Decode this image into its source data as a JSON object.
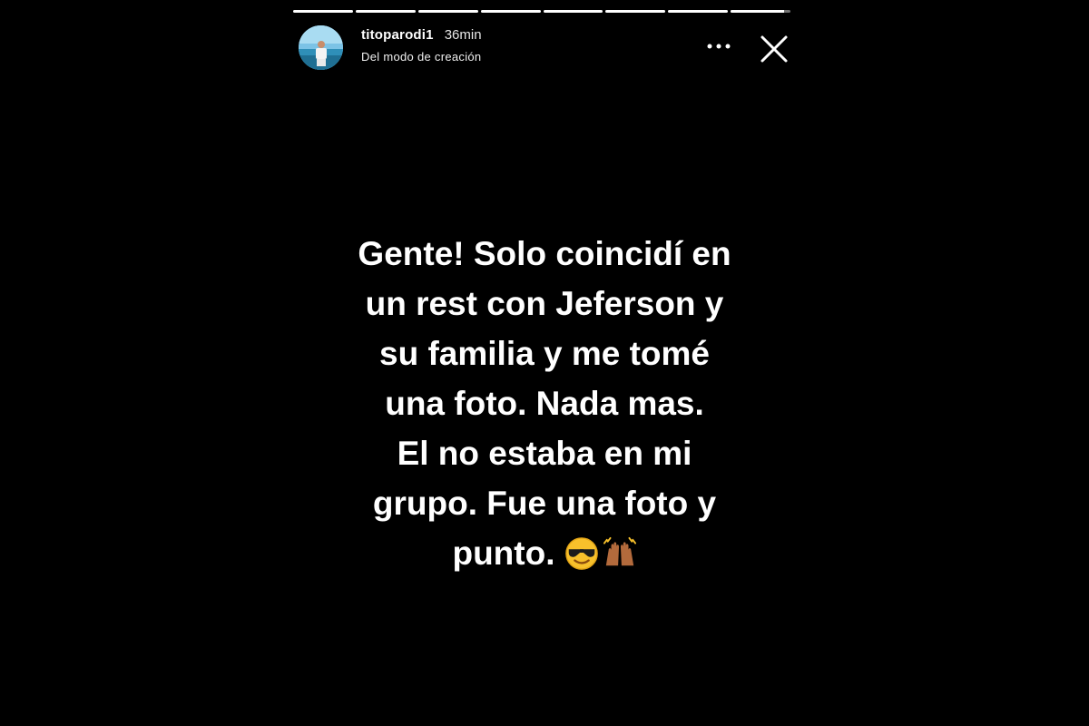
{
  "progress": {
    "segments_total": 8,
    "segments_completed": 7,
    "current_segment_fraction": 0.9
  },
  "header": {
    "username": "titoparodi1",
    "timestamp": "36min",
    "subtitle": "Del modo de creación",
    "more_icon": "more-horizontal-icon",
    "close_icon": "close-icon"
  },
  "story": {
    "lines": [
      "Gente! Solo coincidí en",
      "un rest con Jeferson y",
      "su familia y me tomé",
      "una foto. Nada mas.",
      "El no estaba en mi",
      "grupo. Fue una foto y",
      "punto."
    ],
    "emojis": [
      "sunglasses-face-emoji",
      "raising-hands-emoji"
    ]
  },
  "colors": {
    "background": "#000000",
    "text": "#ffffff"
  }
}
